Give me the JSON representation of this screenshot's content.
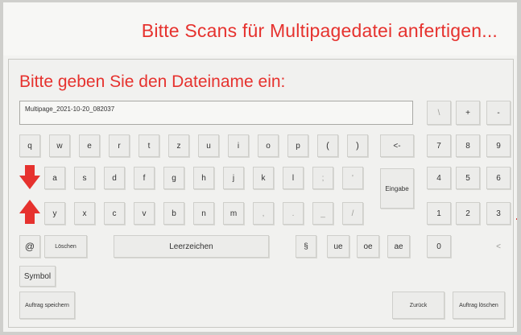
{
  "banner": {
    "title": "Bitte Scans für Multipagedatei anfertigen..."
  },
  "dialog": {
    "prompt": "Bitte geben Sie den Dateiname ein:",
    "filename_value": "Multipage_2021-10-20_082037"
  },
  "keys": {
    "backslash": "\\",
    "plus": "+",
    "minus": "-",
    "row1": [
      "q",
      "w",
      "e",
      "r",
      "t",
      "z",
      "u",
      "i",
      "o",
      "p",
      "(",
      ")"
    ],
    "backspace": "<-",
    "row2": [
      "a",
      "s",
      "d",
      "f",
      "g",
      "h",
      "j",
      "k",
      "l",
      ";",
      "'"
    ],
    "enter": "Eingabe",
    "row3": [
      "y",
      "x",
      "c",
      "v",
      "b",
      "n",
      "m",
      ",",
      ".",
      "_",
      "/"
    ],
    "numpad_row1": [
      "7",
      "8",
      "9"
    ],
    "numpad_row2": [
      "4",
      "5",
      "6"
    ],
    "numpad_row3": [
      "1",
      "2",
      "3"
    ],
    "zero": "0",
    "left_angle": "<",
    "at": "@",
    "delete": "Löschen",
    "space": "Leerzeichen",
    "section": "§",
    "ue": "ue",
    "oe": "oe",
    "ae": "ae",
    "symbol": "Symbol"
  },
  "actions": {
    "save_order": "Auftrag speichern",
    "back": "Zurück",
    "delete_order": "Auftrag löschen"
  },
  "icons": {
    "shift_down": "red-down-arrow-icon",
    "shift_up": "red-up-arrow-icon"
  },
  "colors": {
    "accent_red": "#e6322e",
    "key_background": "#ececea",
    "screen_background": "#f3f3f1"
  }
}
